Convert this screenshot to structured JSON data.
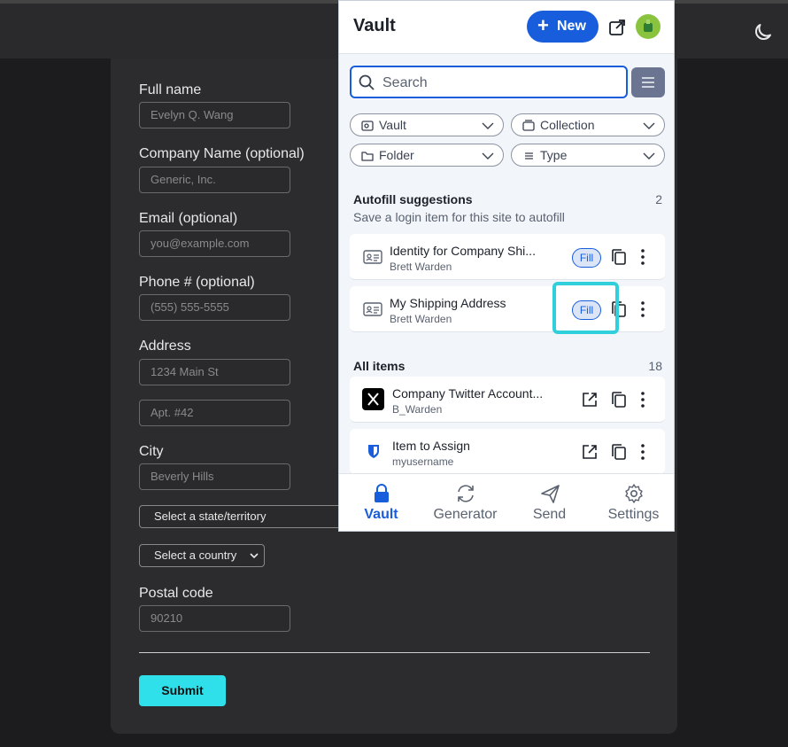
{
  "form": {
    "full_name_label": "Full name",
    "full_name_placeholder": "Evelyn Q. Wang",
    "company_label": "Company Name (optional)",
    "company_placeholder": "Generic, Inc.",
    "email_label": "Email (optional)",
    "email_placeholder": "you@example.com",
    "phone_label": "Phone # (optional)",
    "phone_placeholder": "(555) 555-5555",
    "address_label": "Address",
    "address1_placeholder": "1234 Main St",
    "address2_placeholder": "Apt. #42",
    "city_label": "City",
    "city_placeholder": "Beverly Hills",
    "state_select": "Select a state/territory",
    "country_select": "Select a country",
    "postal_label": "Postal code",
    "postal_placeholder": "90210",
    "submit_label": "Submit"
  },
  "popup": {
    "title": "Vault",
    "new_label": "New",
    "search_placeholder": "Search",
    "filters": [
      "Vault",
      "Collection",
      "Folder",
      "Type"
    ],
    "autofill": {
      "title": "Autofill suggestions",
      "count": "2",
      "subtitle": "Save a login item for this site to autofill",
      "items": [
        {
          "name": "Identity for Company Shi...",
          "user": "Brett Warden",
          "fill": "Fill"
        },
        {
          "name": "My Shipping Address",
          "user": "Brett Warden",
          "fill": "Fill"
        }
      ]
    },
    "all_items": {
      "title": "All items",
      "count": "18",
      "items": [
        {
          "name": "Company Twitter Account...",
          "user": "B_Warden"
        },
        {
          "name": "Item to Assign",
          "user": "myusername"
        }
      ]
    },
    "nav": [
      "Vault",
      "Generator",
      "Send",
      "Settings"
    ]
  },
  "colors": {
    "brand": "#175ddc",
    "highlight": "#2fd0db",
    "submit": "#2fe0ea"
  }
}
